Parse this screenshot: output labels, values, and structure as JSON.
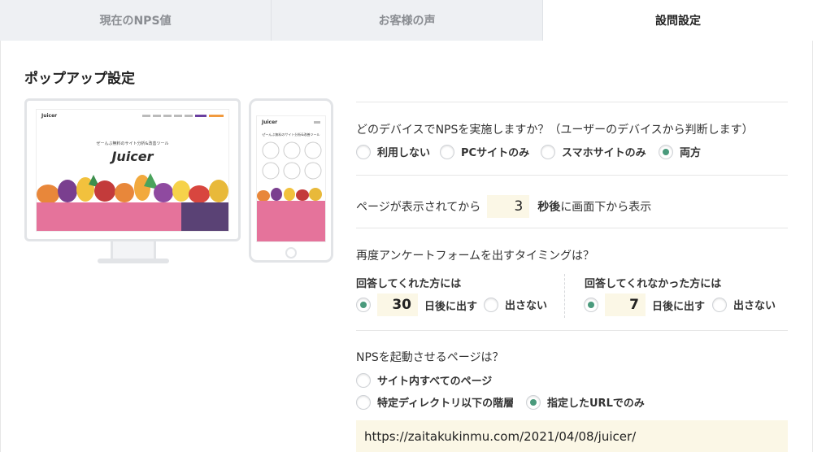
{
  "tabs": [
    {
      "label": "現在のNPS値",
      "active": false
    },
    {
      "label": "お客様の声",
      "active": false
    },
    {
      "label": "設問設定",
      "active": true
    }
  ],
  "section_title": "ポップアップ設定",
  "mockup": {
    "brand_logo": "Juicer",
    "hero_text": "ぜーんぶ無料のサイト分析&改善ツール"
  },
  "device_question": {
    "label": "どのデバイスでNPSを実施しますか？（ユーザーのデバイスから判断します）",
    "options": [
      "利用しない",
      "PCサイトのみ",
      "スマホサイトのみ",
      "両方"
    ],
    "selected": "両方"
  },
  "delay": {
    "prefix": "ページが表示されてから",
    "value": "3",
    "unit": "秒後",
    "suffix": "に画面下から表示"
  },
  "timing": {
    "question": "再度アンケートフォームを出すタイミングは？",
    "answered": {
      "title": "回答してくれた方には",
      "value": "30",
      "after_label": "日後に出す",
      "no_label": "出さない",
      "selected": "after"
    },
    "unanswered": {
      "title": "回答してくれなかった方には",
      "value": "7",
      "after_label": "日後に出す",
      "no_label": "出さない",
      "selected": "after"
    }
  },
  "page_scope": {
    "question": "NPSを起動させるページは？",
    "options": [
      "サイト内すべてのページ",
      "特定ディレクトリ以下の階層",
      "指定したURLでのみ"
    ],
    "selected": "指定したURLでのみ",
    "url": "https://zaitakukinmu.com/2021/04/08/juicer/"
  },
  "colors": {
    "accent_radio": "#4a9a7c",
    "input_bg": "#fbf7e6",
    "pink_banner": "#e5739b"
  }
}
